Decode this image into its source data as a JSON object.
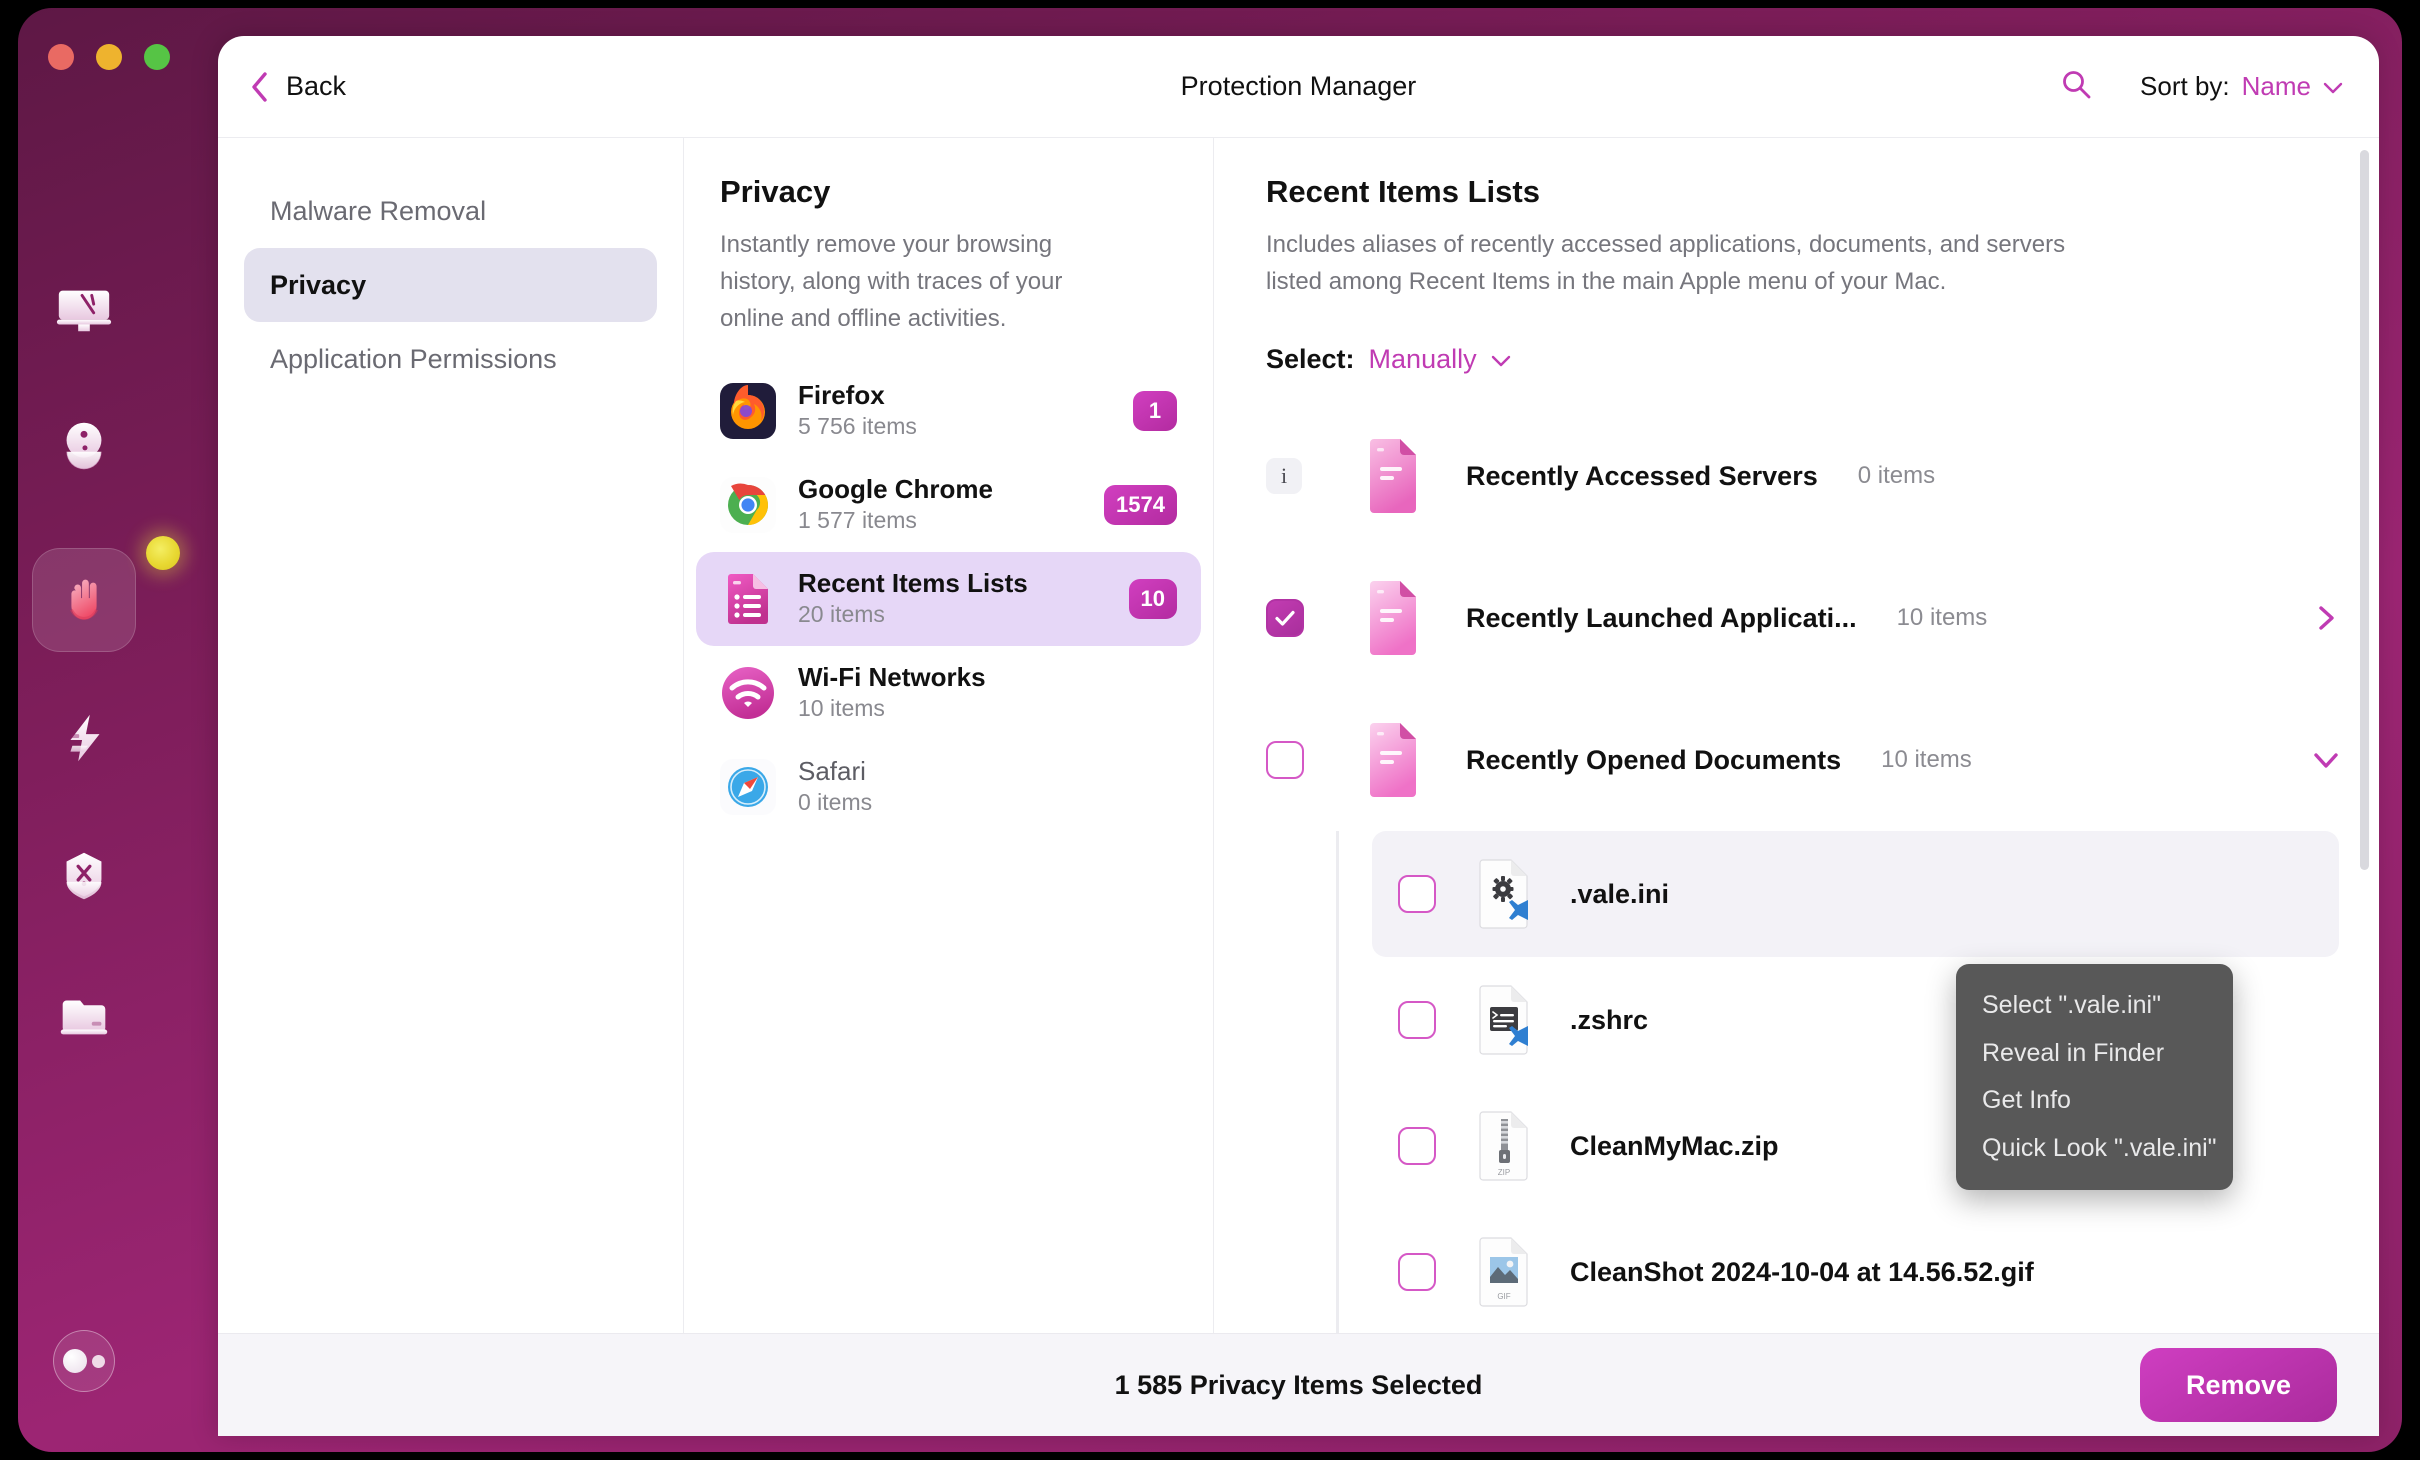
{
  "window": {
    "title": "Protection Manager",
    "back_label": "Back",
    "traffic_lights": [
      "close",
      "minimize",
      "zoom"
    ]
  },
  "toolbar": {
    "search_icon": "search-icon",
    "sort_label": "Sort by:",
    "sort_value": "Name",
    "sort_chevron": "chevron-down-icon"
  },
  "sidebar": {
    "items": [
      {
        "label": "Malware Removal",
        "active": false
      },
      {
        "label": "Privacy",
        "active": true
      },
      {
        "label": "Application Permissions",
        "active": false
      }
    ]
  },
  "rail": {
    "icons": [
      "imac-smart-scan-icon",
      "cleanup-icon",
      "protection-hand-icon",
      "performance-bolt-icon",
      "applications-icon",
      "my-clutter-icon"
    ],
    "active_index": 2,
    "badge": "notification-dot",
    "avatar": "user-avatar"
  },
  "privacy_panel": {
    "title": "Privacy",
    "description": "Instantly remove your browsing history, along with traces of your online and offline activities.",
    "items": [
      {
        "name": "Firefox",
        "sub": "5 756 items",
        "badge": "1",
        "icon": "firefox-icon",
        "selected": false,
        "dim": false
      },
      {
        "name": "Google Chrome",
        "sub": "1 577 items",
        "badge": "1574",
        "icon": "chrome-icon",
        "selected": false,
        "dim": false
      },
      {
        "name": "Recent Items Lists",
        "sub": "20 items",
        "badge": "10",
        "icon": "recent-items-icon",
        "selected": true,
        "dim": false
      },
      {
        "name": "Wi-Fi Networks",
        "sub": "10 items",
        "badge": "",
        "icon": "wifi-icon",
        "selected": false,
        "dim": false
      },
      {
        "name": "Safari",
        "sub": "0 items",
        "badge": "",
        "icon": "safari-icon",
        "selected": false,
        "dim": true
      }
    ]
  },
  "detail_panel": {
    "title": "Recent Items Lists",
    "description": "Includes aliases of recently accessed applications, documents, and servers listed among Recent Items in the main Apple menu of your Mac.",
    "select_label": "Select:",
    "select_value": "Manually",
    "select_chevron": "chevron-down-icon",
    "rows": [
      {
        "name": "Recently Accessed Servers",
        "count": "0 items",
        "lead": "info",
        "checked": false,
        "chevron": "none",
        "icon": "document-alias-icon"
      },
      {
        "name": "Recently Launched Applicati...",
        "count": "10 items",
        "lead": "checkbox",
        "checked": true,
        "chevron": "chevron-right-icon",
        "icon": "document-alias-icon"
      },
      {
        "name": "Recently Opened Documents",
        "count": "10 items",
        "lead": "checkbox",
        "checked": false,
        "chevron": "chevron-down-icon",
        "icon": "document-alias-icon"
      }
    ],
    "sub_rows": [
      {
        "name": ".vale.ini",
        "icon": "ini-file-vscode-icon",
        "checked": false,
        "highlighted": true
      },
      {
        "name": ".zshrc",
        "icon": "shell-file-vscode-icon",
        "checked": false,
        "highlighted": false
      },
      {
        "name": "CleanMyMac.zip",
        "icon": "zip-file-icon",
        "checked": false,
        "highlighted": false
      },
      {
        "name": "CleanShot 2024-10-04 at 14.56.52.gif",
        "icon": "gif-file-icon",
        "checked": false,
        "highlighted": false
      }
    ]
  },
  "context_menu": {
    "items": [
      "Select \".vale.ini\"",
      "Reveal in Finder",
      "Get Info",
      "Quick Look \".vale.ini\""
    ]
  },
  "footer": {
    "summary": "1 585 Privacy Items Selected",
    "remove_label": "Remove"
  },
  "colors": {
    "accent": "#c03bb3",
    "badge": "#c23cb2",
    "selected_row": "#e6d7f7",
    "nav_selected": "#e3e1ee",
    "window_bg": "#6f1b50"
  }
}
